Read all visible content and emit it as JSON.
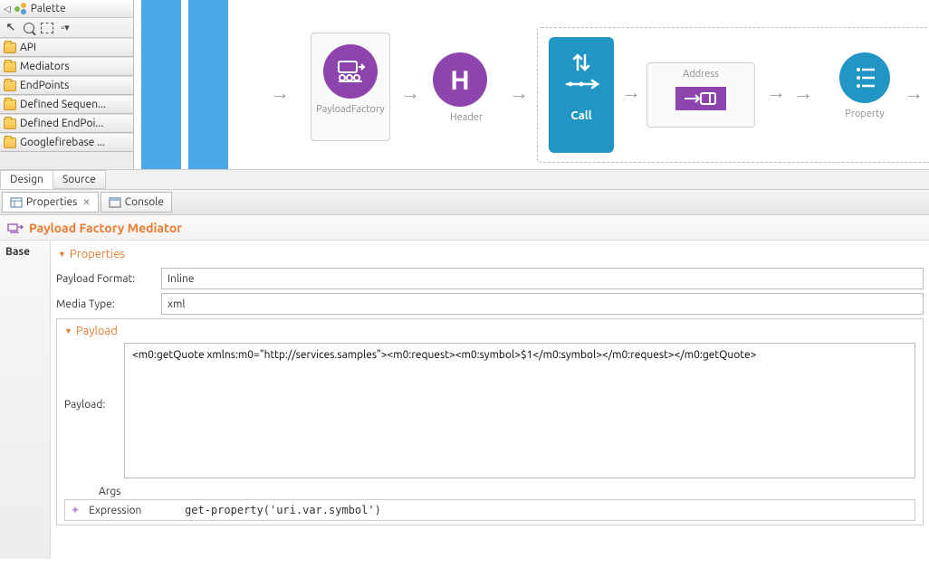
{
  "palette": {
    "title": "Palette",
    "items": [
      "API",
      "Mediators",
      "EndPoints",
      "Defined Sequen...",
      "Defined EndPoi...",
      "Googlefirebase ..."
    ]
  },
  "canvas": {
    "nodes": {
      "payloadFactory": "PayloadFactory",
      "header": "Header",
      "call": "Call",
      "address": "Address",
      "property": "Property"
    }
  },
  "dsTabs": {
    "design": "Design",
    "source": "Source"
  },
  "viewTabs": {
    "properties": "Properties",
    "console": "Console"
  },
  "mediatorTitle": "Payload Factory Mediator",
  "baseLabel": "Base",
  "sections": {
    "properties": "Properties",
    "payload": "Payload"
  },
  "form": {
    "payloadFormatLabel": "Payload Format:",
    "payloadFormatValue": "Inline",
    "mediaTypeLabel": "Media Type:",
    "mediaTypeValue": "xml",
    "payloadLabel": "Payload:",
    "payloadContent": "<m0:getQuote xmlns:m0=\"http://services.samples\"><m0:request><m0:symbol>$1</m0:symbol></m0:request></m0:getQuote>",
    "argsLabel": "Args",
    "argsType": "Expression",
    "argsValue": "get-property('uri.var.symbol')"
  }
}
